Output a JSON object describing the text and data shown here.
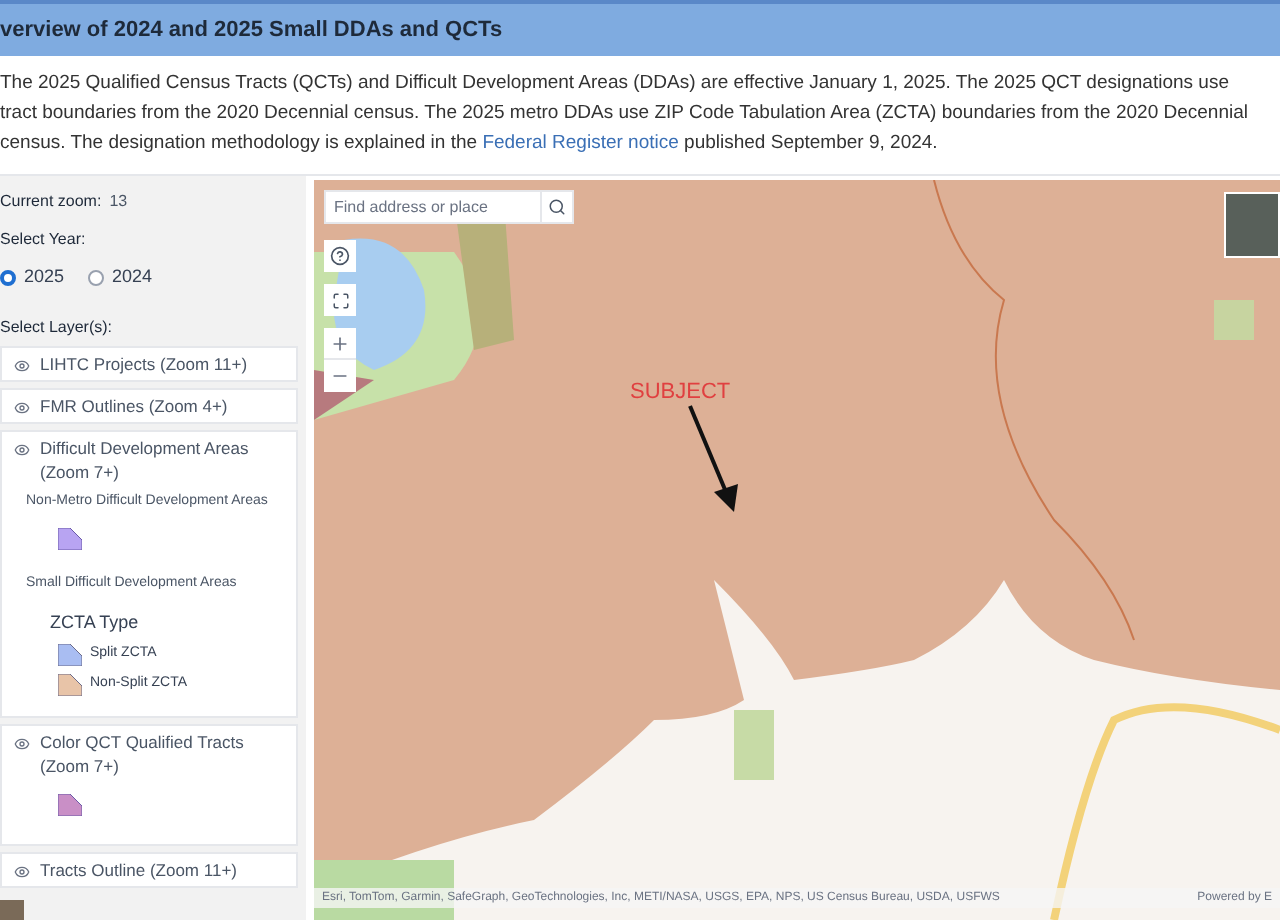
{
  "header": {
    "title": "verview of 2024 and 2025 Small DDAs and QCTs"
  },
  "intro": {
    "text": "The 2025 Qualified Census Tracts (QCTs) and Difficult Development Areas (DDAs) are effective January 1, 2025. The 2025 QCT designations use tract boundaries from the 2020 Decennial census. The 2025 metro DDAs use ZIP Code Tabulation Area (ZCTA) boundaries from the 2020 Decennial census. The designation methodology is explained in the",
    "link": "Federal Register notice",
    "tail": "published September 9, 2024."
  },
  "sidebar": {
    "zoom_label": "Current zoom:",
    "zoom_value": "13",
    "year_label": "Select Year:",
    "years": [
      {
        "label": "2025",
        "selected": true
      },
      {
        "label": "2024",
        "selected": false
      }
    ],
    "layers_label": "Select Layer(s):",
    "layers": [
      {
        "label": "LIHTC Projects (Zoom 11+)"
      },
      {
        "label": "FMR Outlines (Zoom 4+)"
      },
      {
        "label": "Difficult Development Areas (Zoom 7+)",
        "legend": [
          {
            "kind": "heading",
            "label": "Non-Metro Difficult Development Areas"
          },
          {
            "kind": "swatch",
            "color": "#b8a4f2"
          },
          {
            "kind": "heading",
            "label": "Small Difficult Development Areas"
          },
          {
            "kind": "group",
            "label": "ZCTA Type"
          },
          {
            "kind": "item",
            "label": "Split ZCTA",
            "color": "#a9bdf2"
          },
          {
            "kind": "item",
            "label": "Non-Split ZCTA",
            "color": "#e8c4a8"
          }
        ]
      },
      {
        "label": "Color QCT Qualified Tracts (Zoom 7+)",
        "legend": [
          {
            "kind": "swatch",
            "color": "#c98fc6"
          }
        ]
      },
      {
        "label": "Tracts Outline (Zoom 11+)"
      }
    ]
  },
  "map": {
    "search": {
      "placeholder": "Find address or place"
    },
    "annotation": "SUBJECT",
    "attribution": "Esri, TomTom, Garmin, SafeGraph, GeoTechnologies, Inc, METI/NASA, USGS, EPA, NPS, US Census Bureau, USDA, USFWS",
    "powered_by": "Powered by E"
  }
}
